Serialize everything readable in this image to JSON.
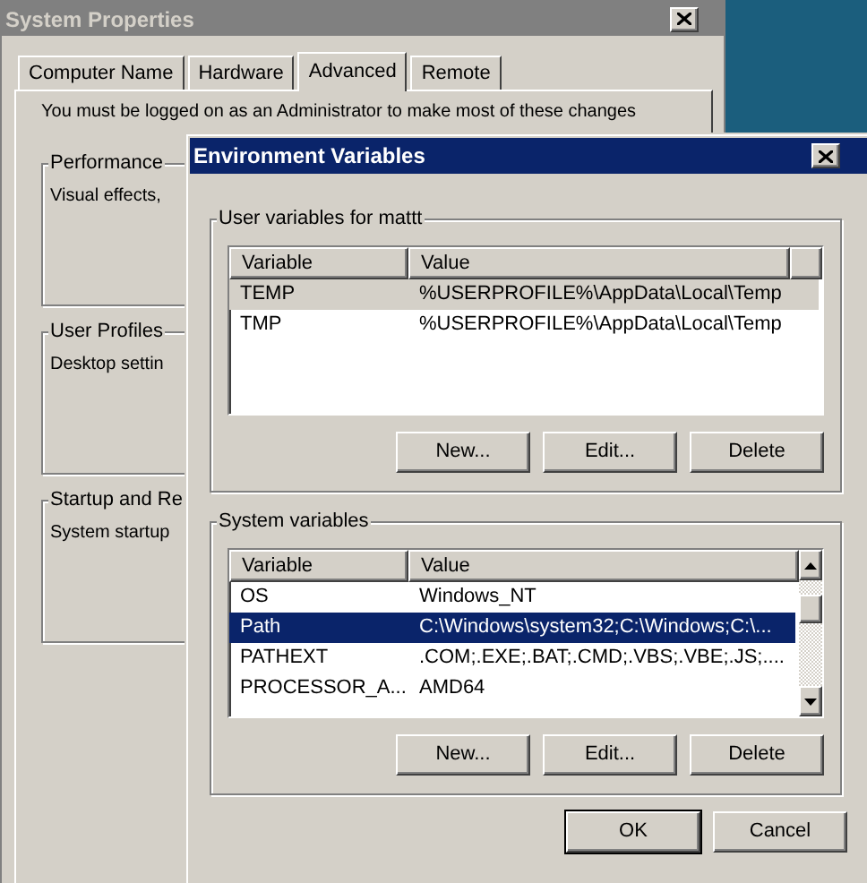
{
  "system_properties": {
    "title": "System Properties",
    "tabs": [
      {
        "label": "Computer Name",
        "selected": false
      },
      {
        "label": "Hardware",
        "selected": false
      },
      {
        "label": "Advanced",
        "selected": true
      },
      {
        "label": "Remote",
        "selected": false
      }
    ],
    "notice": "You must be logged on as an Administrator to make most of these changes",
    "groups": [
      {
        "label": "Performance",
        "text": "Visual effects,"
      },
      {
        "label": "User Profiles",
        "text": "Desktop settin"
      },
      {
        "label": "Startup and Re",
        "text": "System startup"
      }
    ]
  },
  "environment_variables": {
    "title": "Environment Variables",
    "user_variables": {
      "label": "User variables for mattt",
      "focused": false,
      "columns": [
        "Variable",
        "Value"
      ],
      "rows": [
        {
          "variable": "TEMP",
          "value": "%USERPROFILE%\\AppData\\Local\\Temp",
          "selected": true
        },
        {
          "variable": "TMP",
          "value": "%USERPROFILE%\\AppData\\Local\\Temp",
          "selected": false
        }
      ],
      "buttons": [
        "New...",
        "Edit...",
        "Delete"
      ]
    },
    "system_variables": {
      "label": "System variables",
      "focused": true,
      "columns": [
        "Variable",
        "Value"
      ],
      "rows": [
        {
          "variable": "OS",
          "value": "Windows_NT",
          "selected": false
        },
        {
          "variable": "Path",
          "value": "C:\\Windows\\system32;C:\\Windows;C:\\...",
          "selected": true
        },
        {
          "variable": "PATHEXT",
          "value": ".COM;.EXE;.BAT;.CMD;.VBS;.VBE;.JS;....",
          "selected": false
        },
        {
          "variable": "PROCESSOR_A...",
          "value": "AMD64",
          "selected": false
        }
      ],
      "buttons": [
        "New...",
        "Edit...",
        "Delete"
      ]
    },
    "buttons": [
      {
        "label": "OK",
        "default": true
      },
      {
        "label": "Cancel",
        "default": false
      }
    ]
  }
}
